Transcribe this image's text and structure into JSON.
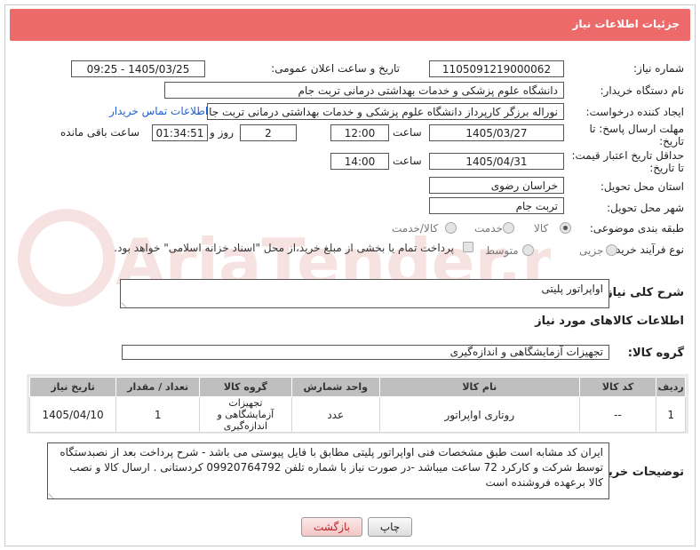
{
  "header": {
    "title": "جزئیات اطلاعات نیاز"
  },
  "watermark": {
    "text": "AriaTender.neT"
  },
  "fields": {
    "need_number": {
      "label": "شماره نیاز:",
      "value": "1105091219000062"
    },
    "announce_datetime": {
      "label": "تاریخ و ساعت اعلان عمومی:",
      "value": "1405/03/25 - 09:25"
    },
    "buyer_org": {
      "label": "نام دستگاه خریدار:",
      "value": "دانشگاه علوم پزشکی و خدمات بهداشتی  درمانی تربت جام"
    },
    "requester": {
      "label": "ایجاد کننده درخواست:",
      "value": "نوراله برزگر کارپرداز دانشگاه علوم پزشکی و خدمات بهداشتی  درمانی تربت جام",
      "contact_link": "اطلاعات تماس خریدار"
    },
    "reply_deadline": {
      "label_line1": "مهلت ارسال پاسخ: تا",
      "label_line2": "تاریخ:",
      "date": "1405/03/27",
      "time_label": "ساعت",
      "time": "12:00",
      "days": "2",
      "days_label": "روز و",
      "remaining": "01:34:51",
      "remaining_label": "ساعت باقی مانده"
    },
    "price_validity": {
      "label_line1": "حداقل تاریخ اعتبار قیمت:",
      "label_line2": "تا تاریخ:",
      "date": "1405/04/31",
      "time_label": "ساعت",
      "time": "14:00"
    },
    "province": {
      "label": "استان محل تحویل:",
      "value": "خراسان رضوی"
    },
    "city": {
      "label": "شهر محل تحویل:",
      "value": "تربت جام"
    },
    "category": {
      "label": "طبقه بندی موضوعی:",
      "options": [
        "کالا",
        "خدمت",
        "کالا/خدمت"
      ],
      "selected": "کالا"
    },
    "process_type": {
      "label": "نوع فرآیند خرید :",
      "options": [
        "جزیی",
        "متوسط"
      ],
      "selected": "جزیی",
      "payment_note": "پرداخت تمام یا بخشی از مبلغ خرید،از محل \"اسناد خزانه اسلامی\" خواهد بود."
    },
    "general_desc": {
      "label": "شرح کلی نیاز:",
      "value": "اواپراتور پلیتی"
    }
  },
  "goods_section": {
    "title": "اطلاعات کالاهای مورد نیاز",
    "group_label": "گروه کالا:",
    "group_value": "تجهیزات آزمایشگاهی و اندازه‌گیری",
    "columns": [
      "ردیف",
      "کد کالا",
      "نام کالا",
      "واحد شمارش",
      "گروه کالا",
      "تعداد / مقدار",
      "تاریخ نیاز"
    ],
    "rows": [
      {
        "row": "1",
        "code": "--",
        "name": "روتاری اواپراتور",
        "unit": "عدد",
        "group": "تجهیزات آزمایشگاهی و اندازه‌گیری",
        "qty": "1",
        "date": "1405/04/10"
      }
    ]
  },
  "buyer_notes": {
    "label": "توضیحات خریدار:",
    "value": "ایران کد مشابه است طبق مشخصات فنی اواپراتور پلیتی مطابق با فایل پیوستی می باشد - شرح پرداخت بعد از نصبدستگاه توسط شرکت و کارکرد  72 ساعت میباشد -در صورت نیاز با شماره تلفن 09920764792  کردستانی . ارسال کالا و نصب کالا برعهده فروشنده است"
  },
  "buttons": {
    "print": "چاپ",
    "back": "بازگشت"
  }
}
